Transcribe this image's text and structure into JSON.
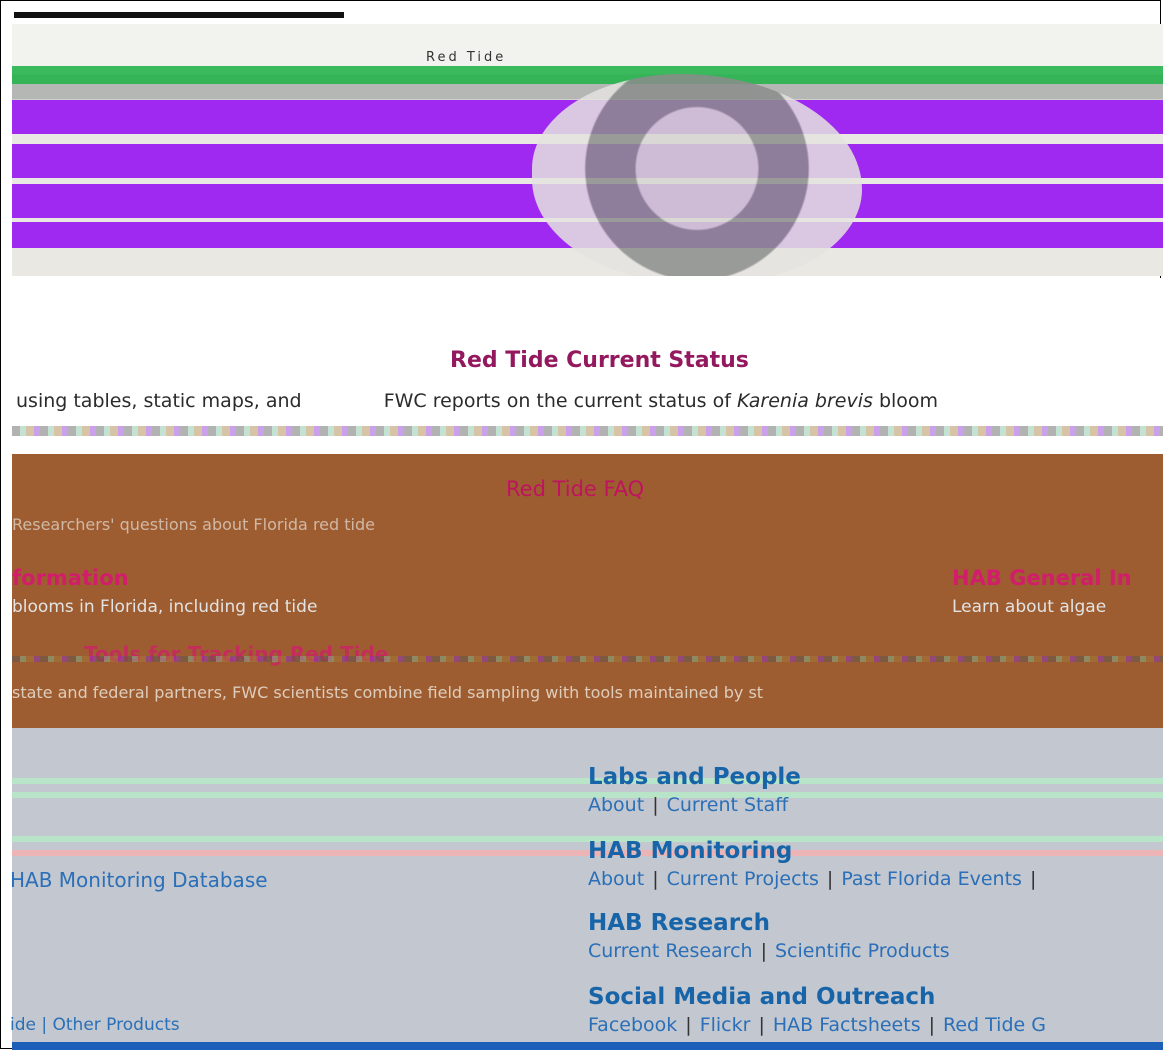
{
  "hero": {
    "title": "Red Tide"
  },
  "status": {
    "title": "Red Tide Current Status",
    "text_prefix": "using tables, static maps, and",
    "text_main": "FWC reports on the current status of ",
    "text_italic": "Karenia brevis",
    "text_suffix": " bloom"
  },
  "faq": {
    "title": "Red Tide FAQ",
    "text": "Researchers' questions about Florida red tide"
  },
  "left_info": {
    "heading": "formation",
    "sub": "blooms in Florida, including red tide"
  },
  "right_info": {
    "heading": "HAB General In",
    "sub": "Learn about algae"
  },
  "tools": {
    "title": "Tools for Tracking Red Tide",
    "text": "state and federal partners, FWC scientists combine field sampling with tools maintained by st"
  },
  "footer": {
    "left_link_1": "HAB Monitoring Database",
    "left_link_2": "ide | Other Products",
    "labs": {
      "heading": "Labs and People",
      "links": [
        "About",
        "Current Staff"
      ]
    },
    "monitoring": {
      "heading": "HAB Monitoring",
      "links": [
        "About",
        "Current Projects",
        "Past Florida Events"
      ]
    },
    "research": {
      "heading": "HAB Research",
      "links": [
        "Current Research",
        "Scientific Products"
      ]
    },
    "social": {
      "heading": "Social Media and Outreach",
      "links": [
        "Facebook",
        "Flickr",
        "HAB Factsheets",
        "Red Tide G"
      ]
    }
  },
  "colors": {
    "hero_purple": "#9b1ff0",
    "brown": "#9d5d31",
    "grey": "#c3c7cf",
    "accent_magenta": "#d21d6a",
    "title_dark_magenta": "#94185e",
    "link_blue": "#2a6fb7",
    "heading_blue": "#1764a8",
    "bottom_blue": "#1b5fb9"
  }
}
